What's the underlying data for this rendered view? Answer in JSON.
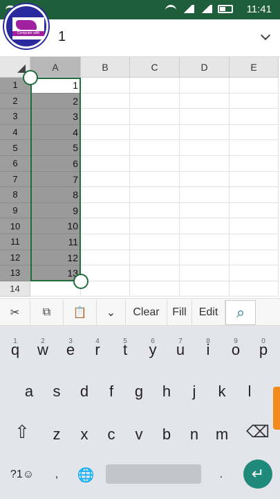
{
  "status": {
    "time": "11:41"
  },
  "logo": {
    "text": "Computer with"
  },
  "formula_bar": {
    "value": "1"
  },
  "columns": [
    "A",
    "B",
    "C",
    "D",
    "E"
  ],
  "rows": [
    {
      "num": "1",
      "a": "1"
    },
    {
      "num": "2",
      "a": "2"
    },
    {
      "num": "3",
      "a": "3"
    },
    {
      "num": "4",
      "a": "4"
    },
    {
      "num": "5",
      "a": "5"
    },
    {
      "num": "6",
      "a": "6"
    },
    {
      "num": "7",
      "a": "7"
    },
    {
      "num": "8",
      "a": "8"
    },
    {
      "num": "9",
      "a": "9"
    },
    {
      "num": "10",
      "a": "10"
    },
    {
      "num": "11",
      "a": "11"
    },
    {
      "num": "12",
      "a": "12"
    },
    {
      "num": "13",
      "a": "13"
    },
    {
      "num": "14",
      "a": ""
    }
  ],
  "toolbar": {
    "cut": "✂",
    "copy": "⧉",
    "paste": "📋",
    "more": "⌄",
    "clear": "Clear",
    "fill": "Fill",
    "edit": "Edit",
    "search": "⌕"
  },
  "keyboard": {
    "row1": [
      {
        "k": "q",
        "h": "1"
      },
      {
        "k": "w",
        "h": "2"
      },
      {
        "k": "e",
        "h": "3"
      },
      {
        "k": "r",
        "h": "4"
      },
      {
        "k": "t",
        "h": "5"
      },
      {
        "k": "y",
        "h": "6"
      },
      {
        "k": "u",
        "h": "7"
      },
      {
        "k": "i",
        "h": "8"
      },
      {
        "k": "o",
        "h": "9"
      },
      {
        "k": "p",
        "h": "0"
      }
    ],
    "row2": [
      "a",
      "s",
      "d",
      "f",
      "g",
      "h",
      "j",
      "k",
      "l"
    ],
    "row3": [
      "z",
      "x",
      "c",
      "v",
      "b",
      "n",
      "m"
    ],
    "shift": "⇧",
    "backspace": "⌫",
    "sym": "?1☺",
    "comma": ",",
    "globe": "🌐",
    "period": ".",
    "enter": "↵"
  }
}
